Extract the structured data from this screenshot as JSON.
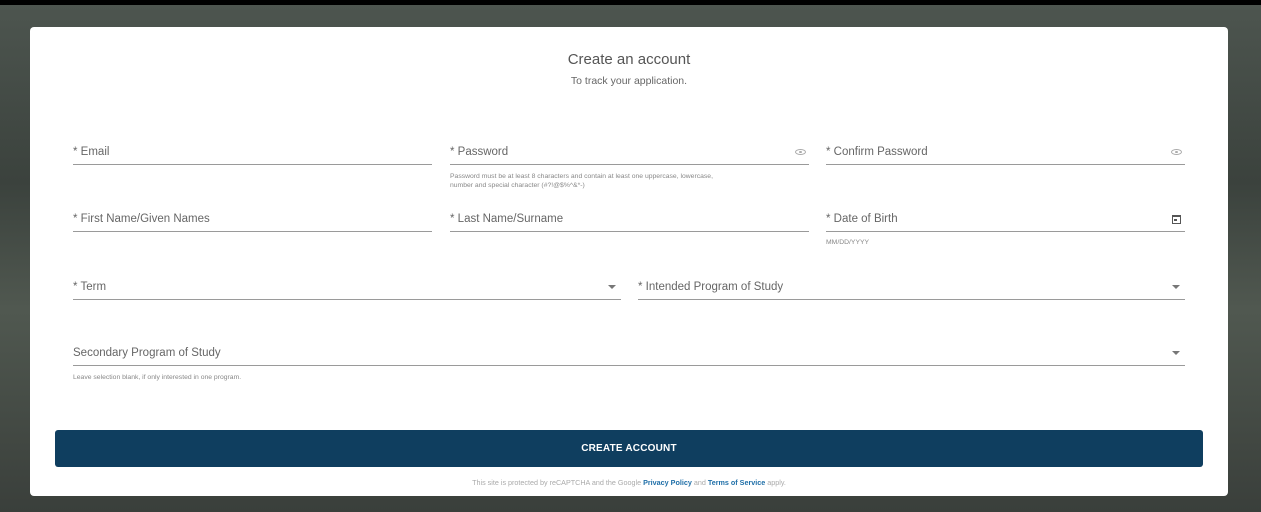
{
  "header": {
    "title": "Create an account",
    "subtitle": "To track your application."
  },
  "fields": {
    "email": {
      "label": "* Email"
    },
    "password": {
      "label": "* Password",
      "hint_line1": "Password must be at least 8 characters and contain at least one uppercase, lowercase,",
      "hint_line2": "number and special character (#?!@$%^&*-)"
    },
    "confirm_password": {
      "label": "* Confirm Password"
    },
    "first_name": {
      "label": "* First Name/Given Names"
    },
    "last_name": {
      "label": "* Last Name/Surname"
    },
    "date_of_birth": {
      "label": "* Date of Birth",
      "hint": "MM/DD/YYYY"
    },
    "term": {
      "label": "* Term"
    },
    "intended_program": {
      "label": "* Intended Program of Study"
    },
    "secondary_program": {
      "label": "Secondary Program of Study",
      "hint": "Leave selection blank, if only interested in one program."
    }
  },
  "actions": {
    "create_account_label": "CREATE ACCOUNT"
  },
  "footer": {
    "text_before": "This site is protected by reCAPTCHA and the Google",
    "privacy_link": "Privacy Policy",
    "text_and": "and",
    "terms_link": "Terms of Service",
    "text_after": "apply."
  },
  "colors": {
    "primary_button": "#0f3e5f",
    "link": "#1f6fa8"
  },
  "icons": {
    "password_toggle": "eye-icon",
    "confirm_password_toggle": "eye-icon",
    "date_picker": "calendar-icon",
    "dropdown": "caret-down-icon"
  }
}
